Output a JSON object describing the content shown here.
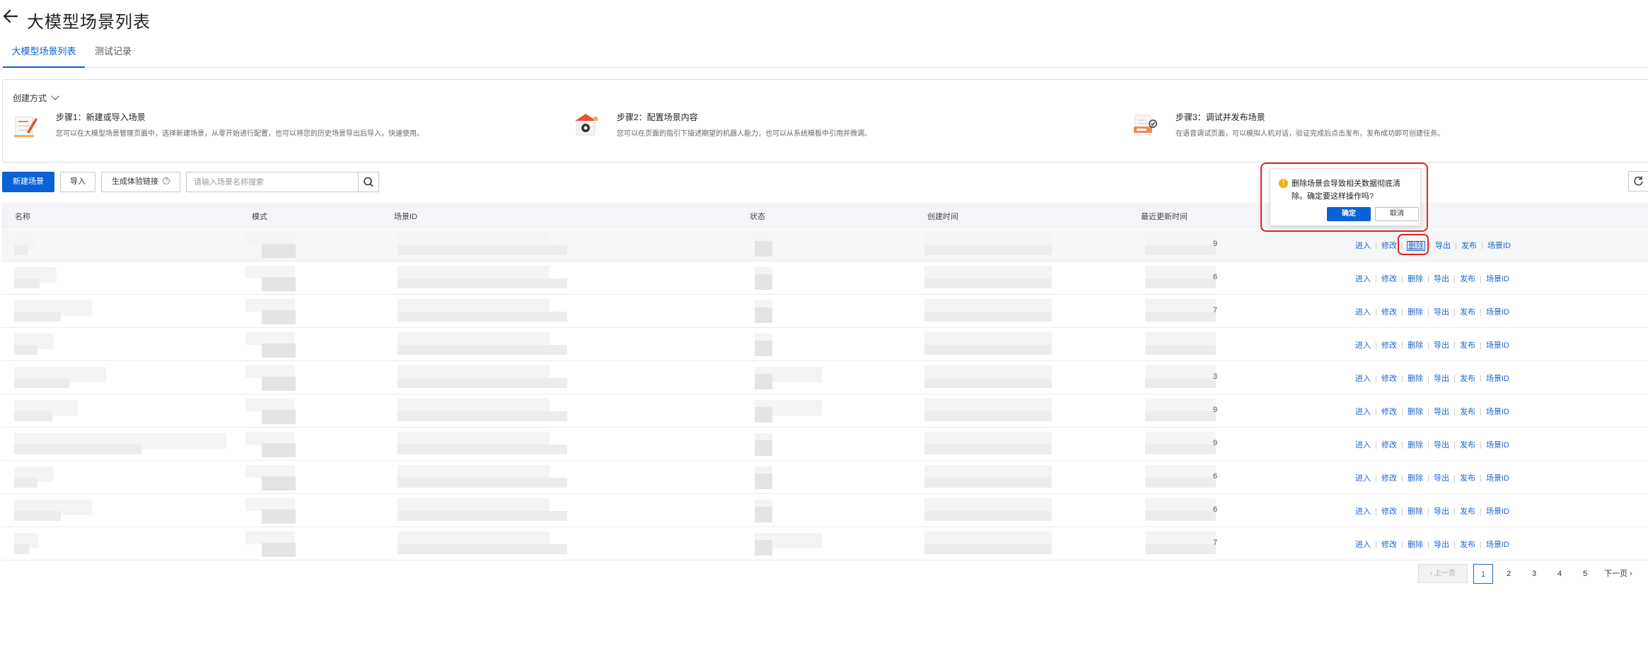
{
  "header": {
    "title": "大模型场景列表"
  },
  "tabs": [
    {
      "label": "大模型场景列表",
      "active": true
    },
    {
      "label": "测试记录",
      "active": false
    }
  ],
  "create_panel": {
    "heading": "创建方式",
    "steps": [
      {
        "title": "步骤1：新建或导入场景",
        "desc": "您可以在大模型场景管理页面中，选择新建场景，从零开始进行配置，也可以将您的历史场景导出后导入，快速使用。"
      },
      {
        "title": "步骤2：配置场景内容",
        "desc": "您可以在页面的指引下描述期望的机器人能力，也可以从系统模板中引用并微调。"
      },
      {
        "title": "步骤3：调试并发布场景",
        "desc": "在语音调试页面，可以模拟人机对话，验证完成后点击发布，发布成功即可创建任务。"
      }
    ]
  },
  "toolbar": {
    "new_label": "新建场景",
    "import_label": "导入",
    "gen_label": "生成体验链接",
    "help_glyph": "?",
    "search_placeholder": "请输入场景名称搜索"
  },
  "table": {
    "columns": [
      "名称",
      "模式",
      "场景ID",
      "状态",
      "创建时间",
      "最近更新时间"
    ],
    "row_tails": [
      "9",
      "6",
      "7",
      "",
      "3",
      "9",
      "9",
      "6",
      "6",
      "7"
    ],
    "actions": [
      "进入",
      "修改",
      "删除",
      "导出",
      "发布",
      "场景ID"
    ]
  },
  "popconfirm": {
    "icon": "!",
    "message": "删除场景会导致相关数据彻底清除。确定要这样操作吗?",
    "ok_label": "确定",
    "cancel_label": "取消"
  },
  "pagination": {
    "prev_label": "上一页",
    "pages": [
      "1",
      "2",
      "3",
      "4",
      "5"
    ],
    "current": "1",
    "next_label": "下一页"
  },
  "colors": {
    "primary": "#0b62d6",
    "link": "#1f64c8",
    "highlight": "#e02424",
    "warning": "#f5b00b"
  }
}
